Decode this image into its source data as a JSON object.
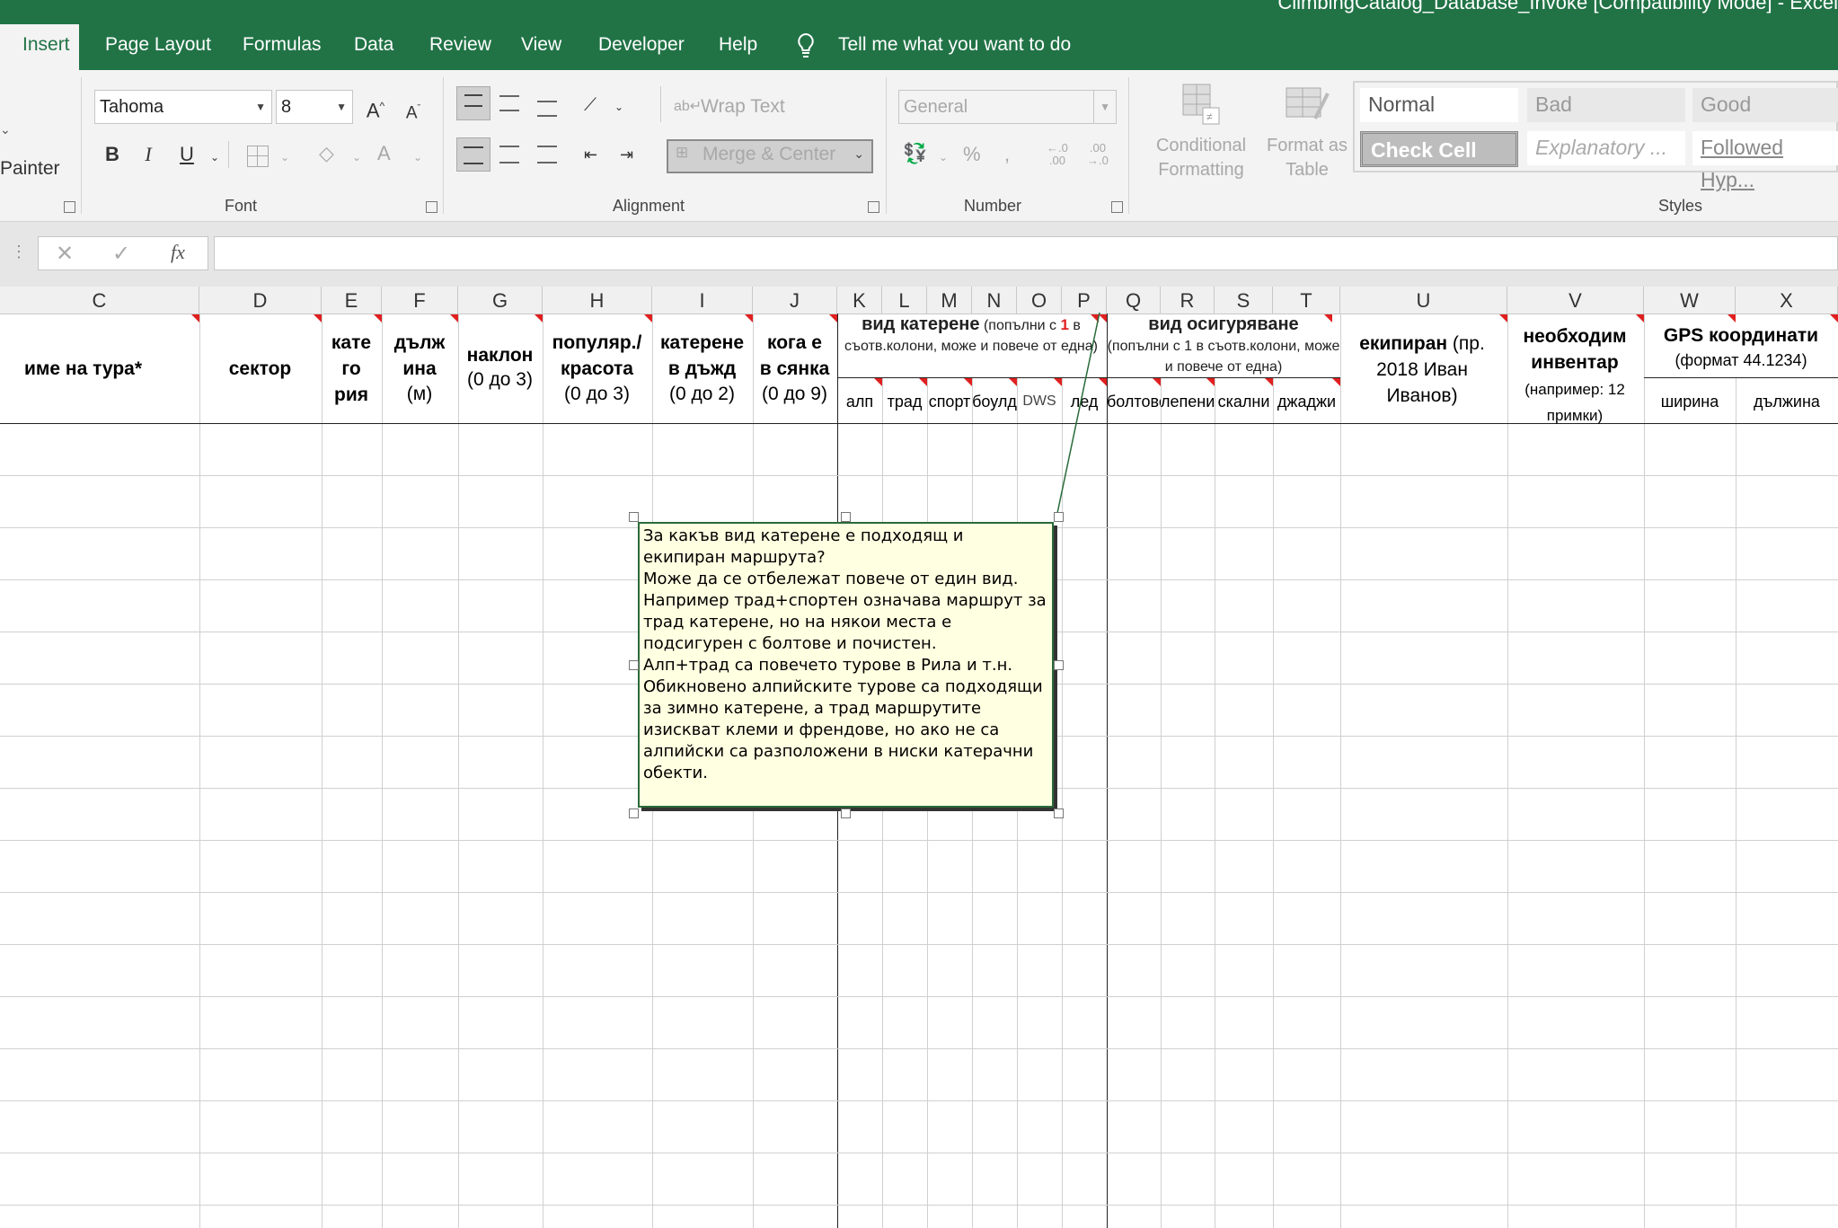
{
  "window_title": "ClimbingCatalog_Database_Invoke  [Compatibility Mode]  -  Excel",
  "menu": [
    "Insert",
    "Page Layout",
    "Formulas",
    "Data",
    "Review",
    "View",
    "Developer",
    "Help"
  ],
  "tell_me": "Tell me what you want to do",
  "clipboard": {
    "format_painter": "Painter"
  },
  "font": {
    "name": "Tahoma",
    "size": "8",
    "group_label": "Font",
    "bold": "B",
    "italic": "I",
    "underline": "U"
  },
  "alignment": {
    "wrap_text": "Wrap Text",
    "merge_center": "Merge & Center",
    "group_label": "Alignment"
  },
  "number": {
    "format": "General",
    "percent": "%",
    "comma": ",",
    "inc_decimal": "←.0\n.00",
    "dec_decimal": ".00\n→.0",
    "group_label": "Number"
  },
  "styles": {
    "conditional": "Conditional\nFormatting",
    "format_table": "Format as\nTable",
    "normal": "Normal",
    "bad": "Bad",
    "good": "Good",
    "check_cell": "Check Cell",
    "explanatory": "Explanatory ...",
    "followed_hyp": "Followed Hyp...",
    "group_label": "Styles"
  },
  "formula_bar": {
    "fx": "fx",
    "cancel": "✕",
    "enter": "✓"
  },
  "columns": [
    "C",
    "D",
    "E",
    "F",
    "G",
    "H",
    "I",
    "J",
    "K",
    "L",
    "M",
    "N",
    "O",
    "P",
    "Q",
    "R",
    "S",
    "T",
    "U",
    "V",
    "W",
    "X"
  ],
  "headers": {
    "name": "име на тура*",
    "sector": "сектор",
    "category": "кате\nго\nрия",
    "length_bold": "дълж\nина",
    "length_unit": "(м)",
    "slope_bold": "наклон",
    "slope_range": "(0 до 3)",
    "popular_bold": "популяр./\nкрасота",
    "popular_range": "(0 до 3)",
    "rain_bold": "катерене\nв дъжд",
    "rain_range": "(0 до 2)",
    "shade_bold": "кога е\nв сянка",
    "shade_range": "(0 до 9)",
    "climb_type_bold": "вид катерене",
    "climb_type_note_a": " (попълни с ",
    "climb_type_one": "1",
    "climb_type_note_b": " в съотв.колони, може и повече от една)",
    "climb_sub": [
      "алп",
      "трад",
      "спорт",
      "боулд",
      "DWS",
      "лед"
    ],
    "protection_bold": "вид осигуряване",
    "protection_note": "(попълни с 1 в съотв.колони, може и повече от една)",
    "protection_sub": [
      "болтове",
      "лепени",
      "скални",
      "джаджи"
    ],
    "equipped_bold": "екипиран",
    "equipped_note": " (пр. 2018 Иван Иванов)",
    "inventory_bold": "необходим инвентар",
    "inventory_note": "(например: 12 примки)",
    "gps_bold": "GPS координати",
    "gps_note": "(формат 44.1234)",
    "gps_sub": [
      "ширина",
      "дължина"
    ]
  },
  "comment": "За какъв вид катерене е подходящ и екипиран маршрута?\nМоже да се отбележат повече от един вид. Например трад+спортен означава маршрут за трад катерене, но на някои места е подсигурен с болтове и почистен.\nАлп+трад са повечето турове в Рила и т.н. Обикновено алпийските турове са подходящи за зимно катерене, а трад маршрутите изискват клеми и френдове, но ако не са алпийски са разположени в ниски катерачни обекти."
}
